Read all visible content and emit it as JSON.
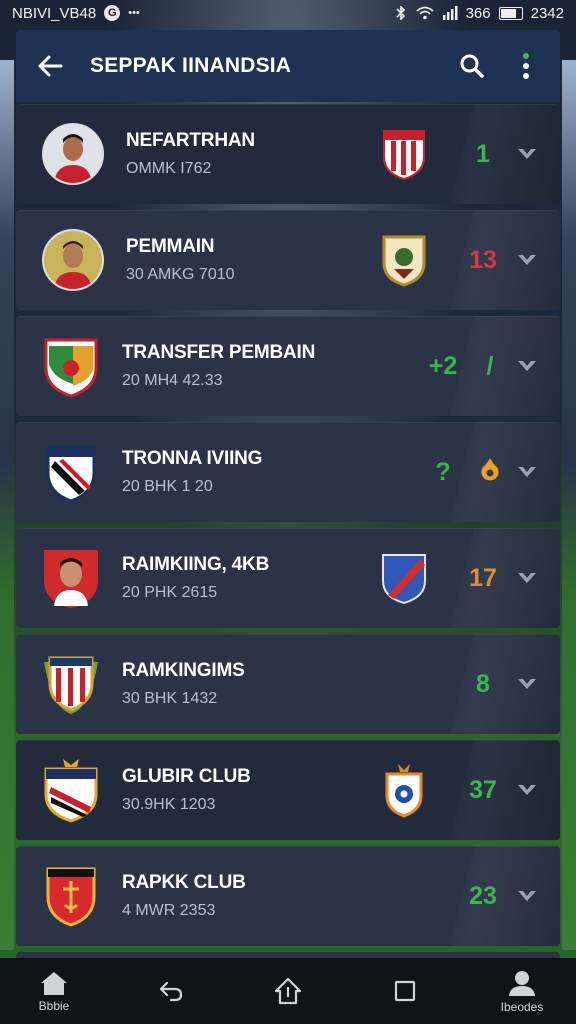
{
  "status_bar": {
    "left_text": "NBIVI_VB48",
    "left_glyph": "G",
    "dots": "•••",
    "right_text": "366",
    "time": "2342"
  },
  "app_bar": {
    "title": "SEPPAK IINANDSIA",
    "back_icon": "arrow-left-icon",
    "search_icon": "search-icon",
    "more_icon": "more-vertical-icon"
  },
  "rows": [
    {
      "title": "NEFARTRHAN",
      "subtitle": "OMMK I762",
      "value": "1",
      "value_color": "#35b54a",
      "avatar": "player-photo",
      "club_badge": "red-white-striped-shield"
    },
    {
      "title": "PEMMAIN",
      "subtitle": "30 AMKG 7010",
      "value": "13",
      "value_color": "#d8313b",
      "avatar": "player-photo",
      "club_badge": "gold-crest-shield"
    },
    {
      "title": "TRANSFER PEMBAIN",
      "subtitle": "20 MH4 42.33",
      "value": "+2",
      "value_color": "#35b54a",
      "extra": "/",
      "extra_color": "#35b54a",
      "avatar": "club-crest"
    },
    {
      "title": "TRONNA IVIING",
      "subtitle": "20 BHK 1 20",
      "value": "?",
      "value_color": "#35b54a",
      "extra_icon": "fire-icon",
      "avatar": "club-crest"
    },
    {
      "title": "RAIMKIING, 4KB",
      "subtitle": "20 PHK 2615",
      "value": "17",
      "value_color": "#e38a2c",
      "avatar": "player-photo",
      "club_badge": "blue-red-diagonal-shield"
    },
    {
      "title": "RAMKINGIMS",
      "subtitle": "30 BHK 1432",
      "value": "8",
      "value_color": "#35b54a",
      "avatar": "club-crest"
    },
    {
      "title": "GLUBIR CLUB",
      "subtitle": "30.9HK 1203",
      "value": "37",
      "value_color": "#35b54a",
      "avatar": "club-crest",
      "club_badge": "orange-blue-crest"
    },
    {
      "title": "RAPKK CLUB",
      "subtitle": "4 MWR 2353",
      "value": "23",
      "value_color": "#35b54a",
      "avatar": "club-crest"
    }
  ],
  "bottom_nav": [
    {
      "label": "Bbbie",
      "icon": "home-icon"
    },
    {
      "label": "",
      "icon": "back-nav-icon"
    },
    {
      "label": "",
      "icon": "share-icon"
    },
    {
      "label": "",
      "icon": "square-icon"
    },
    {
      "label": "Ibeodes",
      "icon": "profile-icon"
    }
  ],
  "colors": {
    "app_bar": "#1e3253",
    "row": "#2b3447",
    "row_dark": "#222b3b",
    "positive": "#35b54a",
    "negative": "#d8313b",
    "warning": "#e38a2c"
  }
}
